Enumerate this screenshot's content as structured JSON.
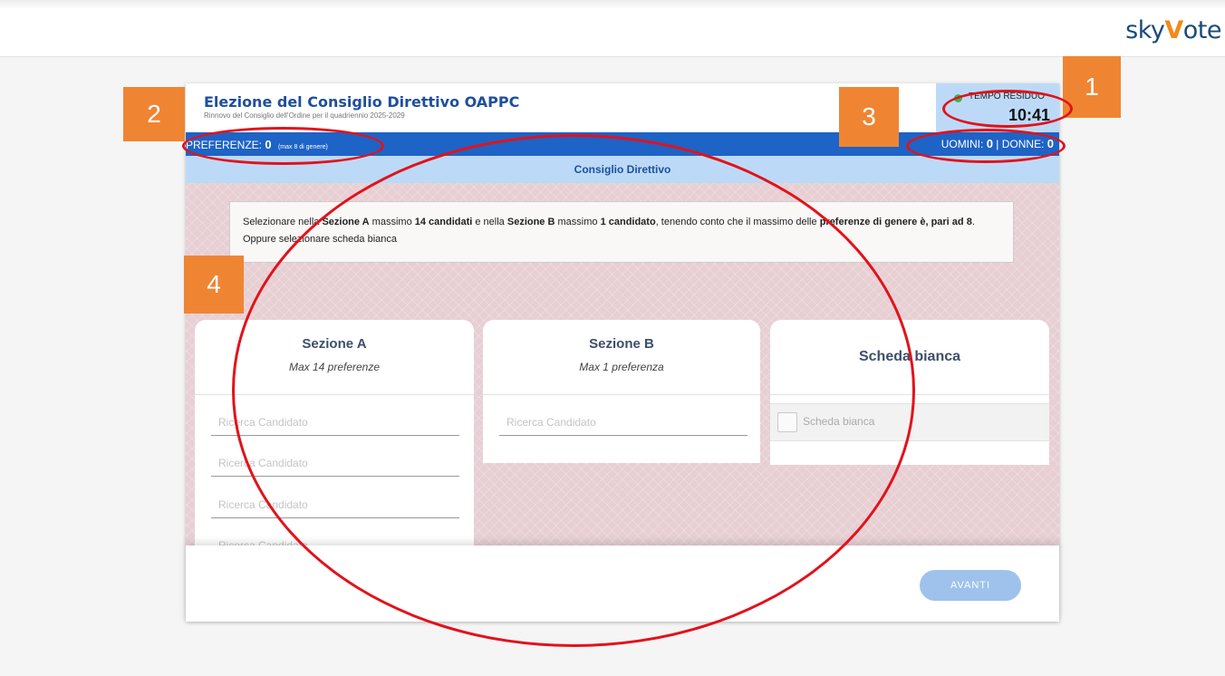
{
  "brand": {
    "prefix": "sky",
    "accent": "V",
    "suffix": "ote"
  },
  "header": {
    "title": "Elezione del Consiglio Direttivo OAPPC",
    "subtitle": "Rinnovo del Consiglio dell'Ordine per il quadriennio 2025-2029"
  },
  "timer": {
    "label": "TEMPO RESIDUO",
    "value": "10:41"
  },
  "preferences": {
    "label": "PREFERENZE:",
    "count": "0",
    "note": "(max 8 di genere)"
  },
  "gender": {
    "men_label": "UOMINI:",
    "men": "0",
    "sep": "|",
    "women_label": "DONNE:",
    "women": "0"
  },
  "section_title": "Consiglio Direttivo",
  "instructions": {
    "p1": "Selezionare nella ",
    "b1": "Sezione A",
    "p2": " massimo ",
    "b2": "14 candidati",
    "p3": " e nella ",
    "b3": "Sezione B",
    "p4": " massimo ",
    "b4": "1 candidato",
    "p5": ", tenendo conto che il massimo delle ",
    "b5": "preferenze di genere è, pari ad 8",
    "p6": ". Oppure selezionare scheda bianca"
  },
  "panels": {
    "a": {
      "title": "Sezione A",
      "subtitle": "Max 14 preferenze"
    },
    "b": {
      "title": "Sezione B",
      "subtitle": "Max 1 preferenza"
    },
    "c": {
      "title": "Scheda bianca",
      "option": "Scheda bianca"
    }
  },
  "search_placeholder": "Ricerca Candidato",
  "footer": {
    "next_label": "AVANTI"
  },
  "annotations": [
    "1",
    "2",
    "3",
    "4"
  ],
  "colors": {
    "primary": "#1e63c6",
    "light_blue": "#bcdaf7",
    "annotation": "#ef8533",
    "circle": "#e2121b"
  }
}
